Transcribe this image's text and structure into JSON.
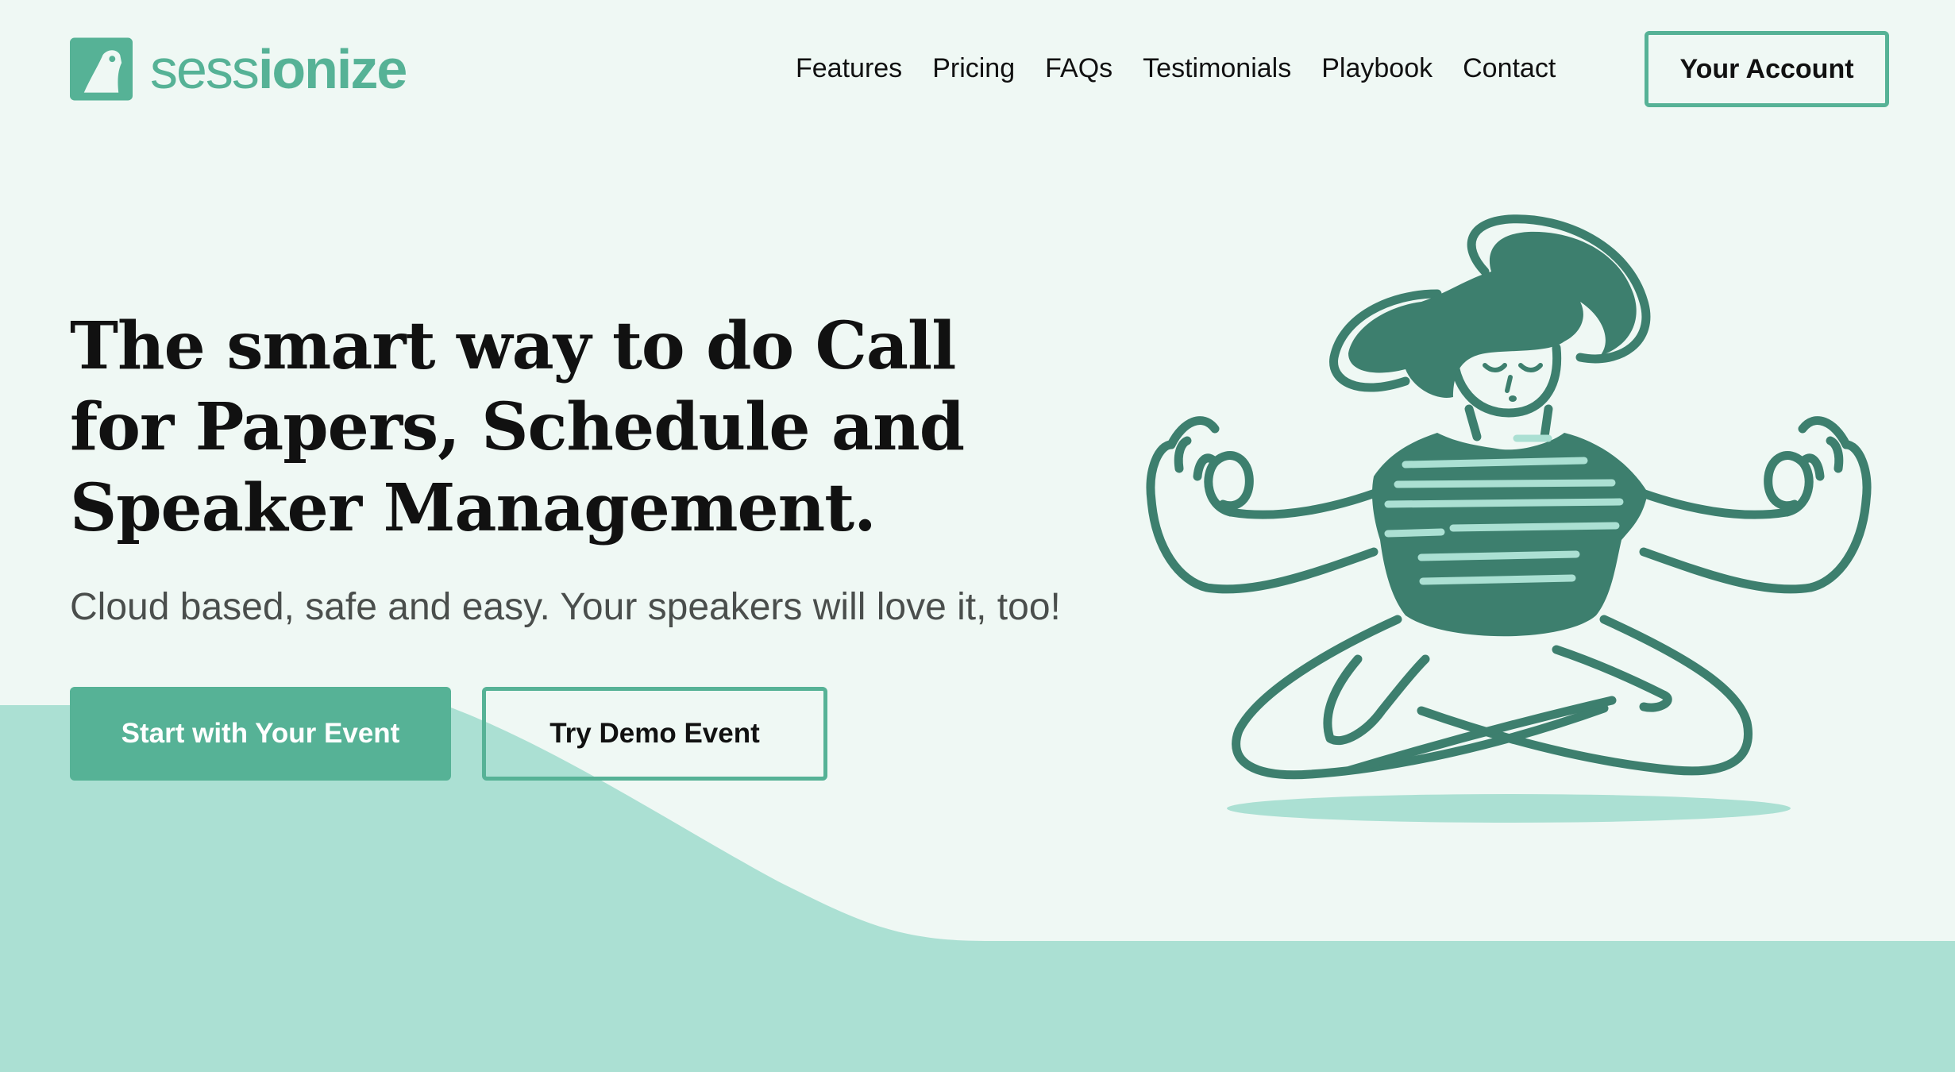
{
  "brand": {
    "name_light": "sess",
    "name_bold": "ionize",
    "accent_color": "#56b296",
    "dark_green": "#3d7f6e",
    "light_green": "#abe0d3",
    "background": "#eff8f4"
  },
  "nav": {
    "items": [
      {
        "label": "Features"
      },
      {
        "label": "Pricing"
      },
      {
        "label": "FAQs"
      },
      {
        "label": "Testimonials"
      },
      {
        "label": "Playbook"
      },
      {
        "label": "Contact"
      }
    ],
    "account_label": "Your Account"
  },
  "hero": {
    "title": "The smart way to do Call for Papers, Schedule and Speaker Management.",
    "subtitle": "Cloud based, safe and easy. Your speakers will love it, too!",
    "primary_cta": "Start with Your Event",
    "secondary_cta": "Try Demo Event",
    "illustration_icon": "meditating-person-illustration"
  }
}
